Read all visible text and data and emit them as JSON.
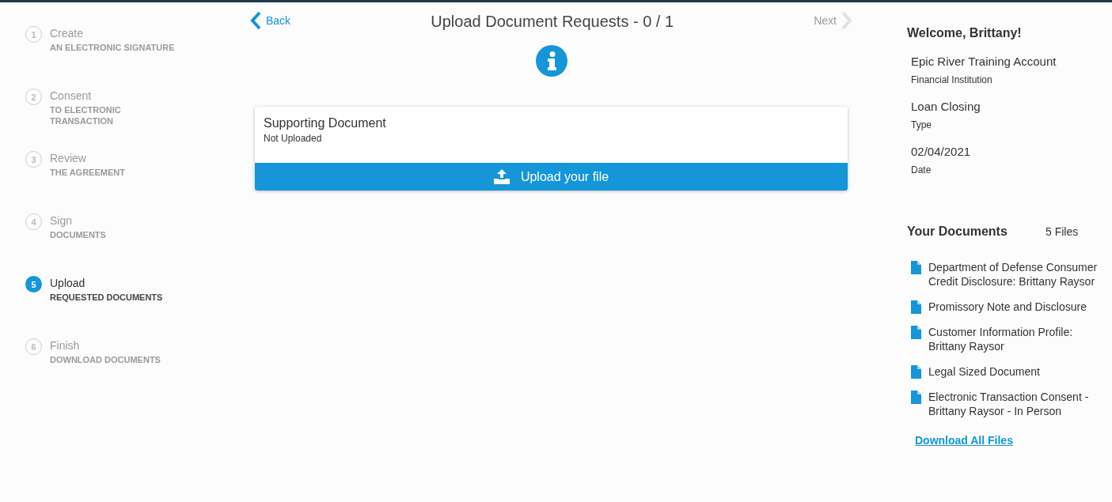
{
  "steps": [
    {
      "number": "1",
      "title": "Create",
      "subtitle": "AN ELECTRONIC SIGNATURE",
      "selected": false
    },
    {
      "number": "2",
      "title": "Consent",
      "subtitle": "TO ELECTRONIC TRANSACTION",
      "selected": false
    },
    {
      "number": "3",
      "title": "Review",
      "subtitle": "THE AGREEMENT",
      "selected": false
    },
    {
      "number": "4",
      "title": "Sign",
      "subtitle": "DOCUMENTS",
      "selected": false
    },
    {
      "number": "5",
      "title": "Upload",
      "subtitle": "REQUESTED DOCUMENTS",
      "selected": true
    },
    {
      "number": "6",
      "title": "Finish",
      "subtitle": "DOWNLOAD DOCUMENTS",
      "selected": false
    }
  ],
  "header": {
    "back": {
      "label": "Back",
      "disabled": false
    },
    "title": "Upload Document Requests - 0 / 1",
    "next": {
      "label": "Next",
      "disabled": true
    }
  },
  "requests": [
    {
      "name": "Supporting Document",
      "status": "Not Uploaded",
      "button": "Upload your file"
    }
  ],
  "sidebar": {
    "welcome": "Welcome, Brittany!",
    "details": [
      {
        "value": "Epic River Training Account",
        "label": "Financial Institution"
      },
      {
        "value": "Loan Closing",
        "label": "Type"
      },
      {
        "value": "02/04/2021",
        "label": "Date"
      }
    ],
    "documents_title": "Your Documents",
    "documents_count": "5 Files",
    "documents": [
      "Department of Defense Consumer Credit Disclosure: Brittany Raysor",
      "Promissory Note and Disclosure",
      "Customer Information Profile: Brittany Raysor",
      "Legal Sized Document",
      "Electronic Transaction Consent - Brittany Raysor - In Person"
    ],
    "download_all": "Download All Files"
  }
}
